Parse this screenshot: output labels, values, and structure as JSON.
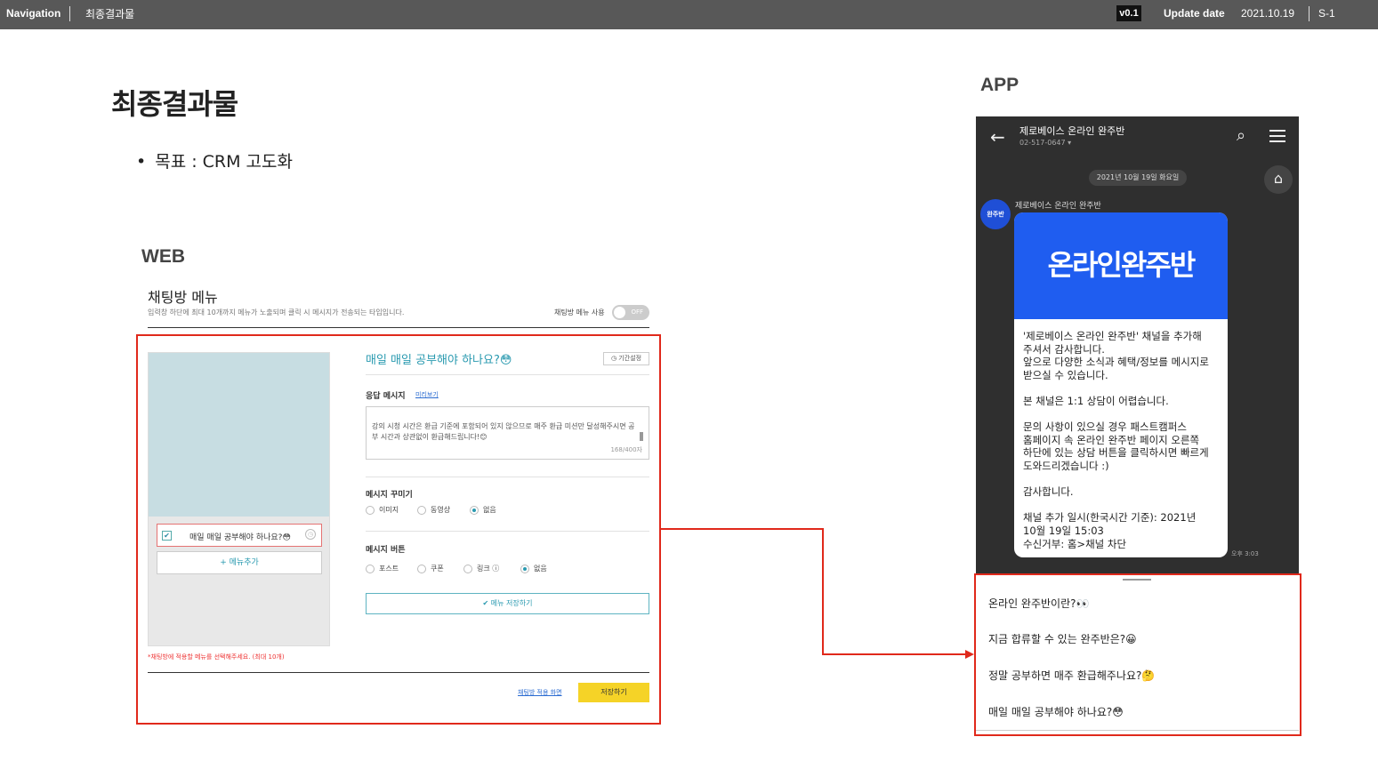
{
  "topbar": {
    "nav_label": "Navigation",
    "breadcrumb": "최종결과물",
    "version": "v0.1",
    "update_label": "Update date",
    "update_date": "2021.10.19",
    "page_code": "S-1"
  },
  "page": {
    "title": "최종결과물",
    "goal": "목표 : CRM 고도화",
    "web_label": "WEB",
    "app_label": "APP"
  },
  "web": {
    "title": "채팅방 메뉴",
    "description": "입력창 하단에 최대 10개까지 메뉴가 노출되며 클릭 시 메시지가 전송되는 타입입니다.",
    "toggle_label": "채팅방 메뉴 사용",
    "toggle_state": "OFF",
    "menu_item": "매일 매일 공부해야 하나요?😳",
    "menu_add": "+ 메뉴추가",
    "note": "*채팅방에 적용할 메뉴를 선택해주세요. (최대 10개)",
    "question_title": "매일 매일 공부해야 하나요?😳",
    "period_button": "기간설정",
    "response_label": "응답 메시지",
    "preview_link": "미리보기",
    "response_text": "강의 시청 시간은 환급 기준에 포함되어 있지 않으므로 매주 환급 미션만 달성해주시면 공부 시간과 상관없이 환급해드립니다!😊",
    "char_count": "168/400자",
    "decor_label": "메시지 꾸미기",
    "decor_options": [
      "이미지",
      "동영상",
      "없음"
    ],
    "decor_selected": "없음",
    "button_label": "메시지 버튼",
    "button_options": [
      "포스트",
      "쿠폰",
      "링크",
      "없음"
    ],
    "button_selected": "없음",
    "save_menu": "✔ 메뉴 저장하기",
    "apply_link": "채팅방 적용 화면",
    "save_button": "저장하기"
  },
  "app": {
    "channel_name": "제로베이스 온라인 완주반",
    "channel_phone": "02-517-0647 ▾",
    "date_chip": "2021년 10월 19일 화요일",
    "avatar_text": "완주반",
    "sender": "제로베이스 온라인 완주반",
    "banner_text": "온라인완주반",
    "message": "'제로베이스 온라인 완주반' 채널을 추가해\n주셔서 감사합니다.\n앞으로 다양한 소식과 혜택/정보를 메시지로\n받으실 수 있습니다.\n\n본 채널은 1:1 상담이 어렵습니다.\n\n문의 사항이 있으실 경우 패스트캠퍼스\n홈페이지 속 온라인 완주반 페이지 오른쪽\n하단에 있는 상담 버튼을 클릭하시면 빠르게\n도와드리겠습니다 :)\n\n감사합니다.\n\n채널 추가 일시(한국시간 기준): 2021년\n10월 19일 15:03\n수신거부: 홈>채널 차단",
    "time": "오후 3:03",
    "menu_items": [
      "온라인 완주반이란?👀",
      "지금 합류할 수 있는 완주반은?😀",
      "정말 공부하면 매주 환급해주나요?🤔",
      "매일 매일 공부해야 하나요?😳"
    ]
  },
  "colors": {
    "topbar": "#585858",
    "highlight_red": "#e0291b",
    "accent_teal": "#2a9ab0",
    "save_yellow": "#f5d327",
    "banner_blue": "#1f5df0"
  }
}
